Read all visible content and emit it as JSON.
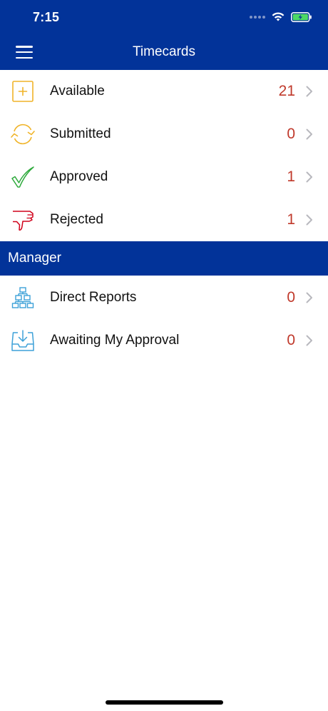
{
  "status_bar": {
    "time": "7:15"
  },
  "nav": {
    "title": "Timecards"
  },
  "timecards": [
    {
      "label": "Available",
      "count": "21",
      "icon": "add-box-icon"
    },
    {
      "label": "Submitted",
      "count": "0",
      "icon": "refresh-arrows-icon"
    },
    {
      "label": "Approved",
      "count": "1",
      "icon": "checkmark-icon"
    },
    {
      "label": "Rejected",
      "count": "1",
      "icon": "thumbs-down-icon"
    }
  ],
  "manager": {
    "header": "Manager",
    "items": [
      {
        "label": "Direct Reports",
        "count": "0",
        "icon": "org-chart-icon"
      },
      {
        "label": "Awaiting My Approval",
        "count": "0",
        "icon": "inbox-download-icon"
      }
    ]
  },
  "colors": {
    "primary": "#023399",
    "count": "#c0392b",
    "available": "#f0b429",
    "approved": "#2eaa3c",
    "rejected": "#d0021b",
    "manager_icon": "#3da1d8"
  }
}
